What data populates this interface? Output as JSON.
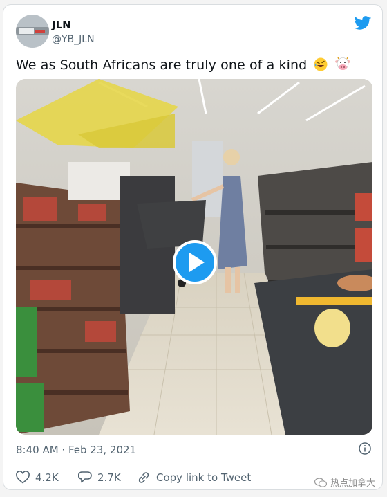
{
  "tweet": {
    "display_name": "JLN",
    "handle": "@YB_JLN",
    "text": "We as South Africans are truly one of a kind",
    "emojis": [
      "rolling-on-floor-laughing-emoji",
      "cow-face-emoji"
    ],
    "timestamp": "8:40 AM · Feb 23, 2021",
    "video": {
      "state": "paused",
      "scene": "supermarket aisle"
    }
  },
  "actions": {
    "likes": "4.2K",
    "replies": "2.7K",
    "copy_link": "Copy link to Tweet"
  },
  "icons": {
    "brand": "twitter-bird-icon",
    "like": "heart-icon",
    "reply": "speech-bubble-icon",
    "link": "link-icon",
    "info": "info-icon",
    "play": "play-icon"
  },
  "colors": {
    "accent": "#1d9bf0",
    "secondary_text": "#536471",
    "primary_text": "#0f1419"
  },
  "watermark": "热点加拿大"
}
